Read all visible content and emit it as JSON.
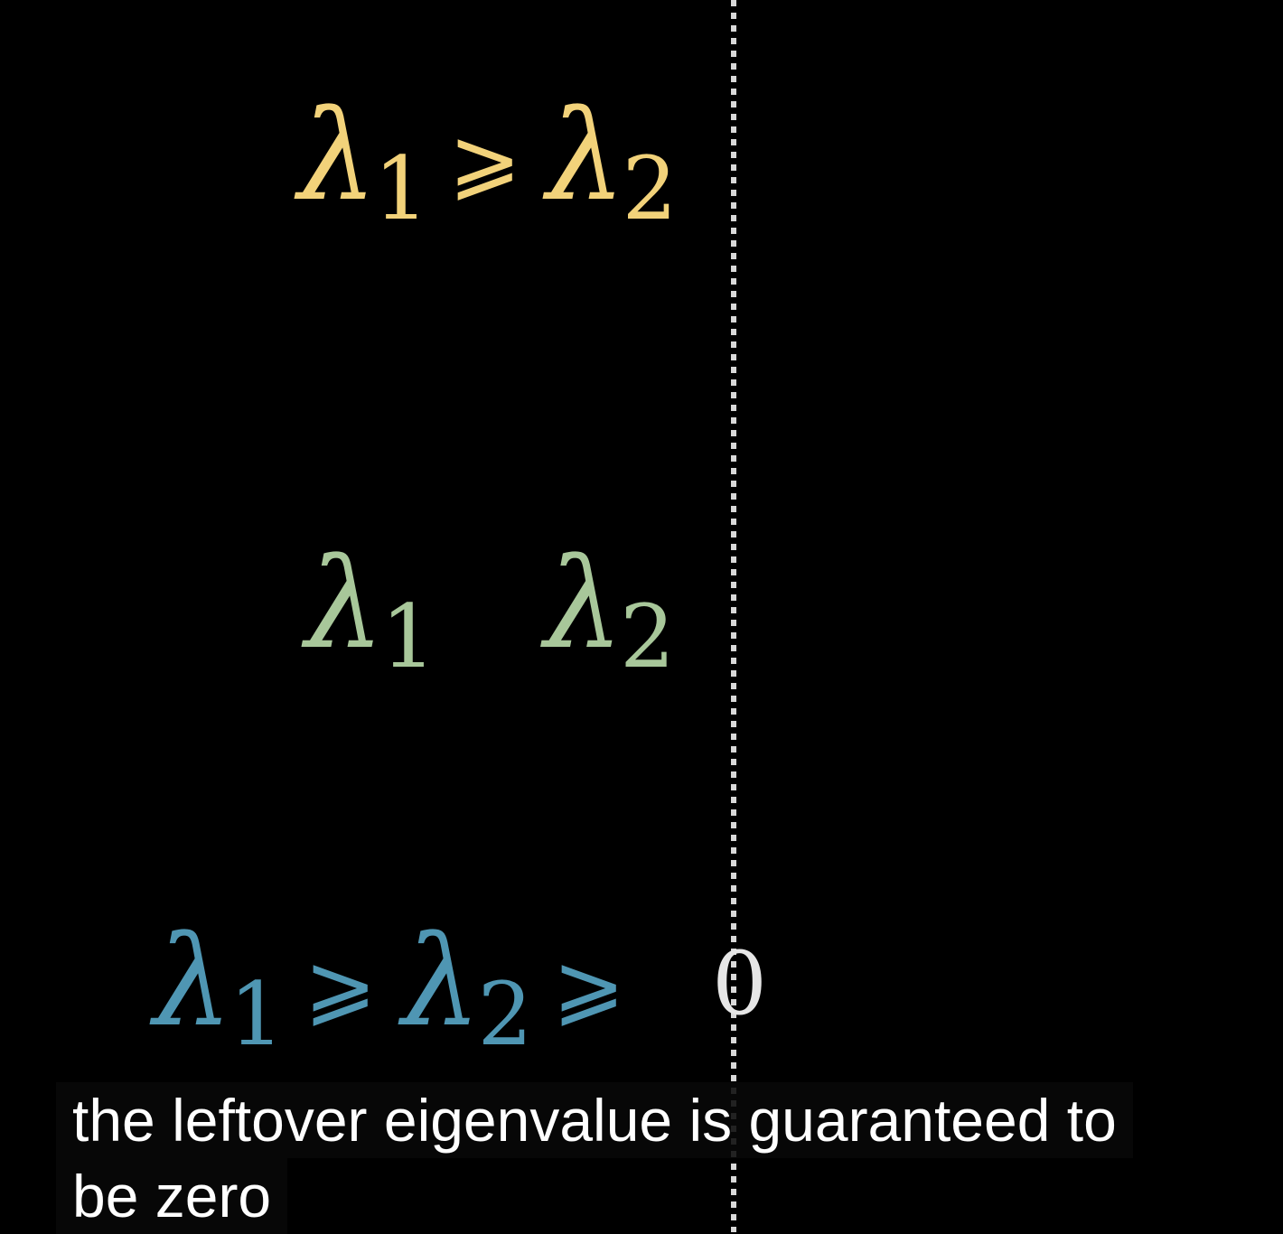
{
  "colors": {
    "background": "#000000",
    "divider": "#d9d9d9",
    "row1": "#f2d27a",
    "row2": "#a8c79a",
    "row3": "#4f96b3",
    "zero": "#e6e6e6",
    "caption_text": "#ffffff"
  },
  "rows": [
    {
      "lambda1": "λ",
      "sub1": "1",
      "rel1": "⩾",
      "lambda2": "λ",
      "sub2": "2"
    },
    {
      "lambda1": "λ",
      "sub1": "1",
      "lambda2": "λ",
      "sub2": "2"
    },
    {
      "lambda1": "λ",
      "sub1": "1",
      "rel1": "⩾",
      "lambda2": "λ",
      "sub2": "2",
      "rel2": "⩾",
      "zero": "0"
    }
  ],
  "caption": {
    "line1": "the leftover eigenvalue is guaranteed to",
    "line2": "be zero"
  }
}
